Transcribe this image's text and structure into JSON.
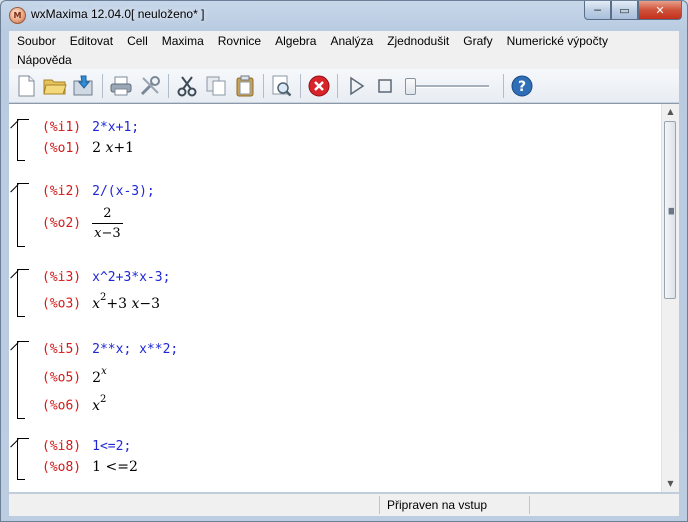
{
  "window": {
    "title": "wxMaxima 12.04.0[ neuloženo* ]",
    "app_icon": "wxmaxima-icon",
    "buttons": {
      "minimize": "─",
      "maximize": "▭",
      "close": "✕"
    }
  },
  "menu": {
    "items": [
      "Soubor",
      "Editovat",
      "Cell",
      "Maxima",
      "Rovnice",
      "Algebra",
      "Analýza",
      "Zjednodušit",
      "Grafy",
      "Numerické výpočty",
      "Nápověda"
    ]
  },
  "toolbar": {
    "icons": [
      "new-document-icon",
      "open-folder-icon",
      "save-icon",
      "print-icon",
      "settings-icon",
      "cut-icon",
      "copy-icon",
      "paste-icon",
      "find-icon",
      "stop-interrupt-icon",
      "play-icon",
      "stop-icon",
      "animation-slider",
      "help-icon"
    ]
  },
  "cells": [
    {
      "input_label": "(%i1)",
      "input": "2*x+1;",
      "outputs": [
        {
          "label": "(%o1)",
          "a": "2 ",
          "b": "x",
          "c": "+1"
        }
      ]
    },
    {
      "input_label": "(%i2)",
      "input": "2/(x-3);",
      "outputs": [
        {
          "label": "(%o2)",
          "num": "2",
          "den_var": "x",
          "den_rest": "−3"
        }
      ]
    },
    {
      "input_label": "(%i3)",
      "input": "x^2+3*x-3;",
      "outputs": [
        {
          "label": "(%o3)",
          "var1": "x",
          "exp": "2",
          "mid": "+3 ",
          "var2": "x",
          "rest": "−3"
        }
      ]
    },
    {
      "input_label": "(%i5)",
      "input": "2**x; x**2;",
      "outputs": [
        {
          "label": "(%o5)",
          "base": "2",
          "exp": "x"
        },
        {
          "label": "(%o6)",
          "base": "x",
          "exp": "2"
        }
      ]
    },
    {
      "input_label": "(%i8)",
      "input": "1<=2;",
      "outputs": [
        {
          "label": "(%o8)",
          "text": "1 <=2"
        }
      ]
    }
  ],
  "status": {
    "text": "Připraven na vstup"
  }
}
